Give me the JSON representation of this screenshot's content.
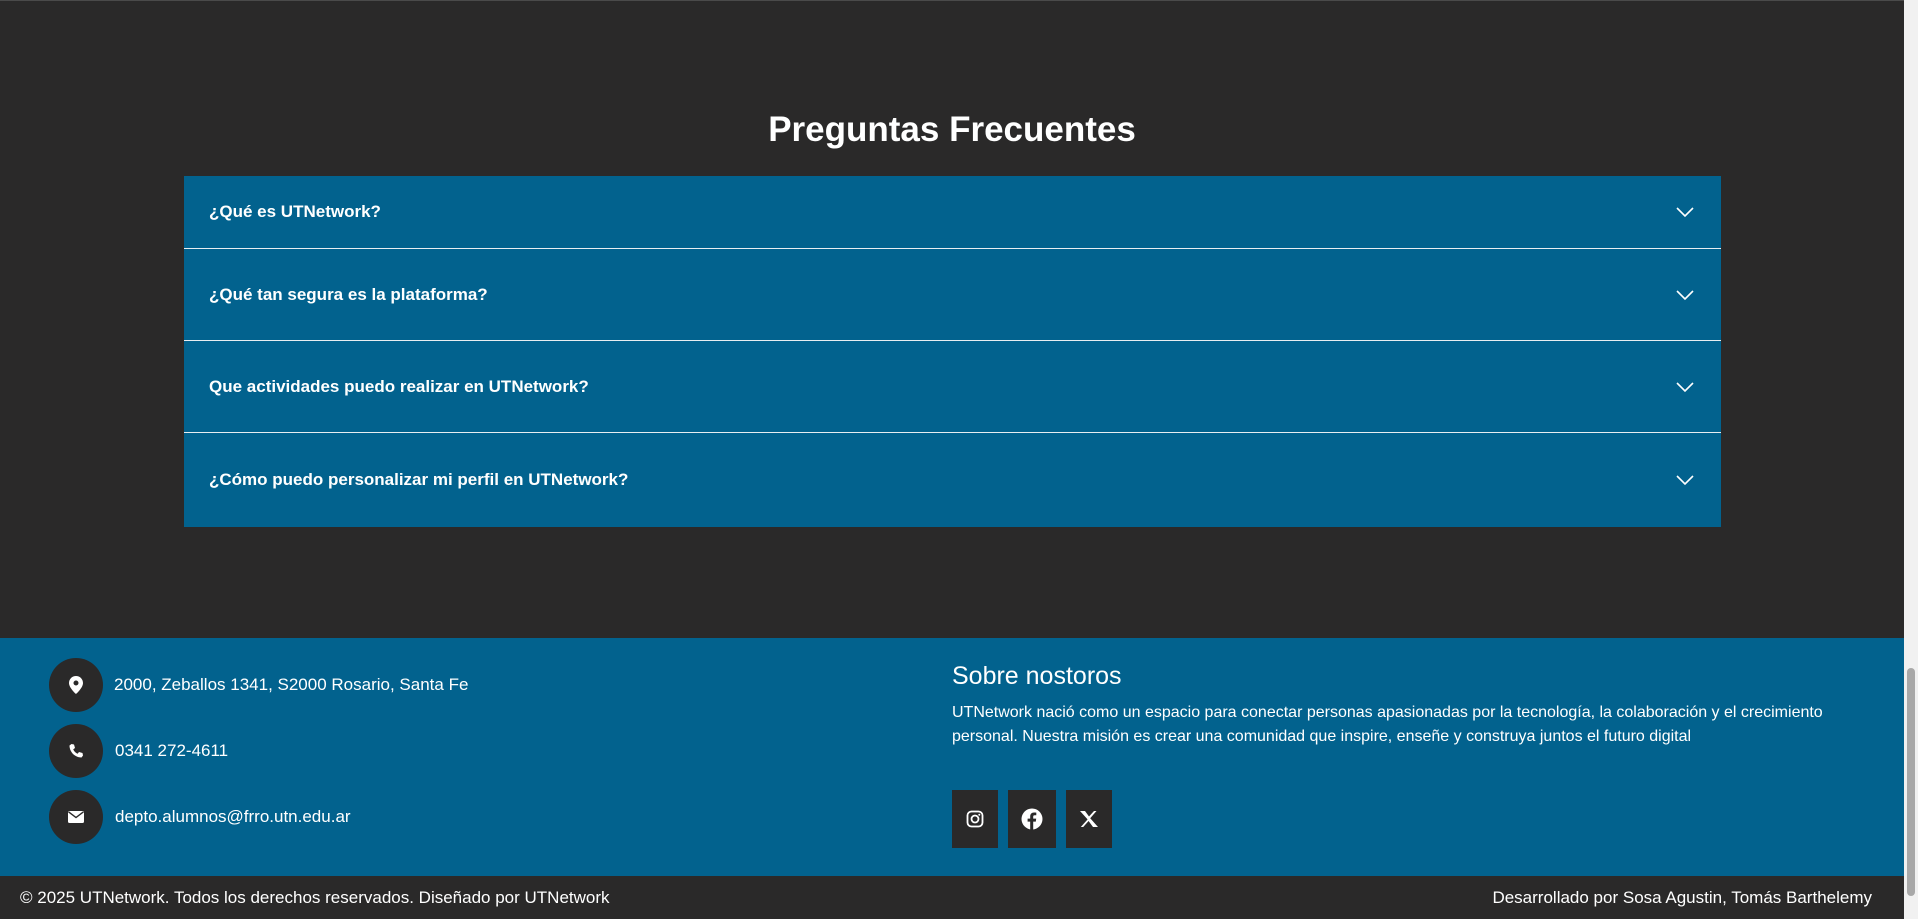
{
  "faq": {
    "title": "Preguntas Frecuentes",
    "items": [
      {
        "question": "¿Qué es UTNetwork?"
      },
      {
        "question": "¿Qué tan segura es la plataforma?"
      },
      {
        "question": "Que actividades puedo realizar en UTNetwork?"
      },
      {
        "question": "¿Cómo puedo personalizar mi perfil en UTNetwork?"
      }
    ],
    "chevron_icon": "chevron-down-icon"
  },
  "contact": {
    "address": "2000, Zeballos 1341, S2000 Rosario, Santa Fe",
    "phone": "0341 272-4611",
    "email": "depto.alumnos@frro.utn.edu.ar",
    "icons": [
      "location-pin-icon",
      "phone-icon",
      "envelope-icon"
    ]
  },
  "about": {
    "title": "Sobre nostoros",
    "text": "UTNetwork nació como un espacio para conectar personas apasionadas por la tecnología, la colaboración y el crecimiento personal. Nuestra misión es crear una comunidad que inspire, enseñe y construya juntos el futuro digital"
  },
  "socials": [
    "instagram-icon",
    "facebook-icon",
    "x-icon"
  ],
  "footer": {
    "copyright": "© 2025 UTNetwork. Todos los derechos reservados. Diseñado por UTNetwork",
    "credits": "Desarrollado por Sosa Agustin, Tomás Barthelemy"
  },
  "colors": {
    "background": "#2a2929",
    "primary_blue": "#02628e",
    "text": "#ffffff"
  }
}
